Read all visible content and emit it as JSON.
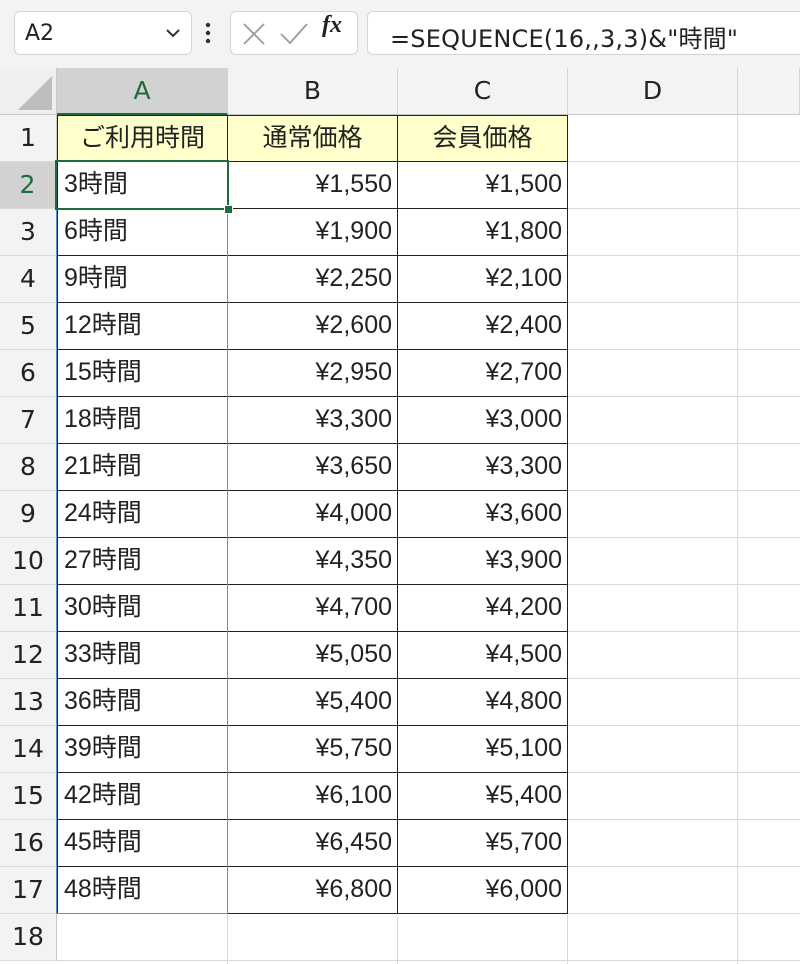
{
  "formula_bar": {
    "name_box": "A2",
    "name_box_icon": "chevron-down-icon",
    "more_icon": "vertical-ellipsis-icon",
    "cancel_icon": "close-icon",
    "enter_icon": "checkmark-icon",
    "fx_label": "fx",
    "formula": "=SEQUENCE(16,,3,3)&\"時間\""
  },
  "sheet": {
    "columns": [
      "A",
      "B",
      "C",
      "D"
    ],
    "selected_column": "A",
    "selected_row": 2,
    "active_cell": "A2",
    "rows": [
      1,
      2,
      3,
      4,
      5,
      6,
      7,
      8,
      9,
      10,
      11,
      12,
      13,
      14,
      15,
      16,
      17,
      18
    ],
    "header": [
      "ご利用時間",
      "通常価格",
      "会員価格"
    ],
    "header_fill": "#ffffcc",
    "data": [
      [
        "3時間",
        "¥1,550",
        "¥1,500"
      ],
      [
        "6時間",
        "¥1,900",
        "¥1,800"
      ],
      [
        "9時間",
        "¥2,250",
        "¥2,100"
      ],
      [
        "12時間",
        "¥2,600",
        "¥2,400"
      ],
      [
        "15時間",
        "¥2,950",
        "¥2,700"
      ],
      [
        "18時間",
        "¥3,300",
        "¥3,000"
      ],
      [
        "21時間",
        "¥3,650",
        "¥3,300"
      ],
      [
        "24時間",
        "¥4,000",
        "¥3,600"
      ],
      [
        "27時間",
        "¥4,350",
        "¥3,900"
      ],
      [
        "30時間",
        "¥4,700",
        "¥4,200"
      ],
      [
        "33時間",
        "¥5,050",
        "¥4,500"
      ],
      [
        "36時間",
        "¥5,400",
        "¥4,800"
      ],
      [
        "39時間",
        "¥5,750",
        "¥5,100"
      ],
      [
        "42時間",
        "¥6,100",
        "¥5,400"
      ],
      [
        "45時間",
        "¥6,450",
        "¥5,700"
      ],
      [
        "48時間",
        "¥6,800",
        "¥6,000"
      ]
    ],
    "accent_color": "#1e6b3f",
    "spill_border_color": "#5b8fd6"
  }
}
